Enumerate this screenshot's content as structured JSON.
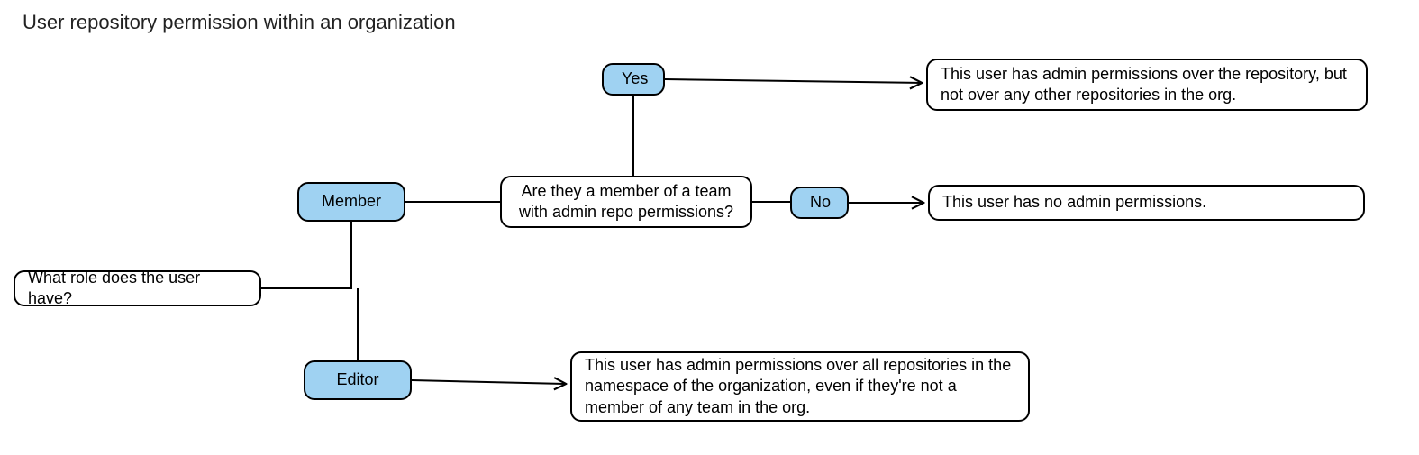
{
  "title": "User repository permission within an organization",
  "nodes": {
    "q_role": "What role does the user have?",
    "member": "Member",
    "editor": "Editor",
    "q_team": "Are they a member of a team with admin repo permissions?",
    "yes": "Yes",
    "no": "No",
    "out_yes": "This user has admin permissions over the repository, but not over any other repositories in the org.",
    "out_no": "This user has no admin permissions.",
    "out_editor": "This user has admin permissions over all repositories in the namespace of the organization, even if they're not a member of any team in the org."
  },
  "colors": {
    "node_blue": "#9fd2f2",
    "stroke": "#000000"
  }
}
